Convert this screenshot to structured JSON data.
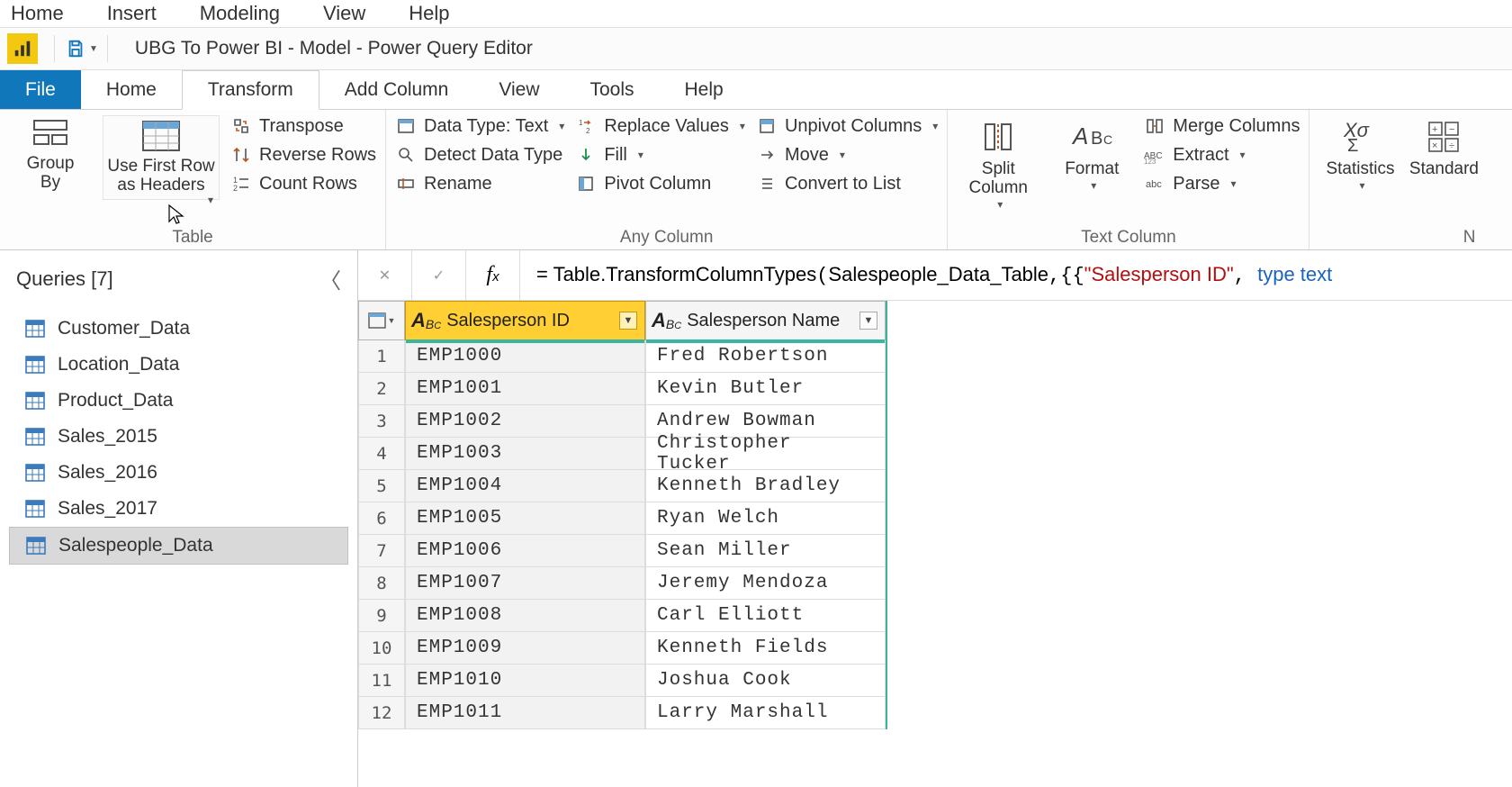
{
  "main_menu": [
    "Home",
    "Insert",
    "Modeling",
    "View",
    "Help"
  ],
  "window_title": "UBG To Power BI - Model - Power Query Editor",
  "ribbon_tabs": {
    "file": "File",
    "items": [
      "Home",
      "Transform",
      "Add Column",
      "View",
      "Tools",
      "Help"
    ],
    "active": "Transform"
  },
  "ribbon": {
    "table_group": {
      "group_by": "Group\nBy",
      "use_headers": "Use First Row\nas Headers",
      "transpose": "Transpose",
      "reverse_rows": "Reverse Rows",
      "count_rows": "Count Rows",
      "label": "Table"
    },
    "anycol_group": {
      "data_type": "Data Type: Text",
      "detect": "Detect Data Type",
      "rename": "Rename",
      "replace": "Replace Values",
      "fill": "Fill",
      "pivot": "Pivot Column",
      "unpivot": "Unpivot Columns",
      "move": "Move",
      "convert": "Convert to List",
      "label": "Any Column"
    },
    "textcol_group": {
      "split": "Split\nColumn",
      "format": "Format",
      "merge": "Merge Columns",
      "extract": "Extract",
      "parse": "Parse",
      "label": "Text Column"
    },
    "numcol_group": {
      "statistics": "Statistics",
      "standard": "Standard",
      "label_partial": "N"
    }
  },
  "queries": {
    "header": "Queries [7]",
    "items": [
      "Customer_Data",
      "Location_Data",
      "Product_Data",
      "Sales_2015",
      "Sales_2016",
      "Sales_2017",
      "Salespeople_Data"
    ],
    "selected_index": 6
  },
  "formula": {
    "prefix": "= ",
    "fn": "Table.TransformColumnTypes",
    "arg1": "Salespeople_Data_Table",
    "col_name": "\"Salesperson ID\"",
    "type_kw": "type text"
  },
  "grid": {
    "columns": [
      {
        "name": "Salesperson ID",
        "selected": true
      },
      {
        "name": "Salesperson Name",
        "selected": false
      }
    ],
    "rows": [
      {
        "id": "EMP1000",
        "name": "Fred Robertson"
      },
      {
        "id": "EMP1001",
        "name": "Kevin Butler"
      },
      {
        "id": "EMP1002",
        "name": "Andrew Bowman"
      },
      {
        "id": "EMP1003",
        "name": "Christopher Tucker"
      },
      {
        "id": "EMP1004",
        "name": "Kenneth Bradley"
      },
      {
        "id": "EMP1005",
        "name": "Ryan Welch"
      },
      {
        "id": "EMP1006",
        "name": "Sean Miller"
      },
      {
        "id": "EMP1007",
        "name": "Jeremy Mendoza"
      },
      {
        "id": "EMP1008",
        "name": "Carl Elliott"
      },
      {
        "id": "EMP1009",
        "name": "Kenneth Fields"
      },
      {
        "id": "EMP1010",
        "name": "Joshua Cook"
      },
      {
        "id": "EMP1011",
        "name": "Larry Marshall"
      }
    ]
  }
}
